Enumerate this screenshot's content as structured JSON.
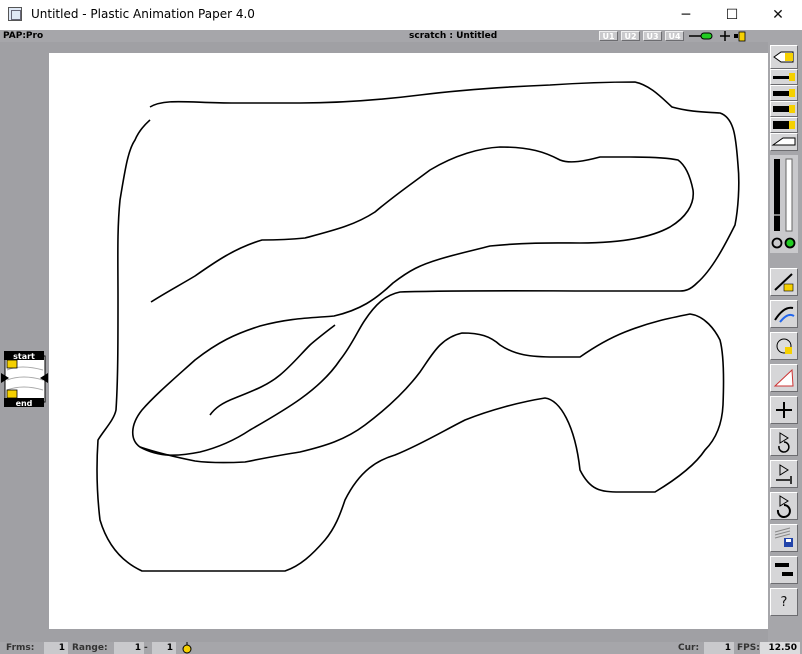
{
  "window": {
    "title": "Untitled - Plastic Animation Paper 4.0",
    "minimize_glyph": "─",
    "maximize_glyph": "☐",
    "close_glyph": "✕"
  },
  "statusbar": {
    "mode": "PAP:Pro",
    "scene": "scratch : Untitled",
    "user_buttons": [
      "U1",
      "U2",
      "U3",
      "U4"
    ]
  },
  "timeline_marker": {
    "start_label": "start",
    "end_label": "end"
  },
  "toolbar": {
    "tools": [
      "pencil-icon",
      "brush-size-1-icon",
      "brush-size-2-icon",
      "brush-size-3-icon",
      "brush-size-4-icon",
      "eraser-icon",
      "opacity-slider",
      "color-picker-icon",
      "onion-skin-icon",
      "lightbox-icon",
      "paper-icon",
      "new-frame-icon",
      "play-loop-icon",
      "play-to-end-icon",
      "play-once-icon",
      "save-icon",
      "flip-icon",
      "help-icon"
    ],
    "help_label": "?"
  },
  "bottom": {
    "frames_label": "Frms:",
    "frames_value": "1",
    "range_label": "Range:",
    "range_start": "1",
    "range_sep": "-",
    "range_end": "1",
    "cur_label": "Cur:",
    "cur_value": "1",
    "fps_label": "FPS:",
    "fps_value": "12.50"
  },
  "colors": {
    "background": "#a0a0a4",
    "canvas": "#ffffff",
    "stroke": "#000000",
    "accent_yellow": "#f5d000",
    "accent_green": "#22cc22"
  }
}
